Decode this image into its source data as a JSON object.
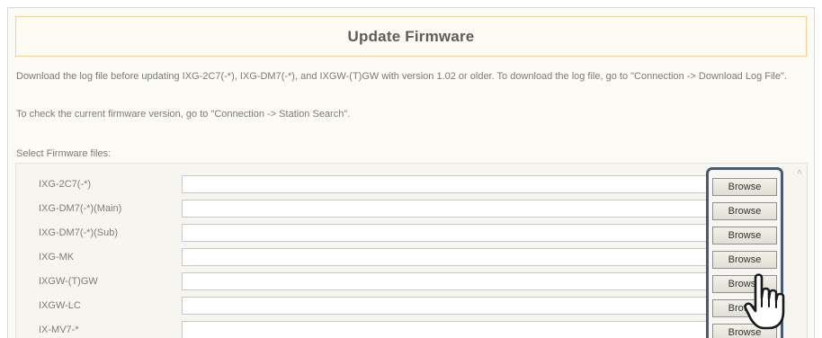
{
  "title": "Update Firmware",
  "notes": {
    "log_warning": "Download the log file before updating IXG-2C7(-*), IXG-DM7(-*), and IXGW-(T)GW with version 1.02 or older. To download the log file, go to \"Connection -> Download Log File\".",
    "version_hint": "To check the current firmware version, go to \"Connection -> Station Search\"."
  },
  "select_label": "Select Firmware files:",
  "rows": [
    {
      "label": "IXG-2C7(-*)",
      "value": "",
      "button": "Browse"
    },
    {
      "label": "IXG-DM7(-*)(Main)",
      "value": "",
      "button": "Browse"
    },
    {
      "label": "IXG-DM7(-*)(Sub)",
      "value": "",
      "button": "Browse"
    },
    {
      "label": "IXG-MK",
      "value": "",
      "button": "Browse"
    },
    {
      "label": "IXGW-(T)GW",
      "value": "",
      "button": "Browse"
    },
    {
      "label": "IXGW-LC",
      "value": "",
      "button": "Browse"
    },
    {
      "label": "IX-MV7-*",
      "value": "",
      "button": "Browse"
    }
  ],
  "colors": {
    "title_border": "#f4cf95",
    "highlight_border": "#4a5a6e",
    "panel_bg": "#f6f5ef"
  },
  "icons": {
    "cursor": "hand-pointer-icon",
    "scroll": "scroll-up-arrow-icon"
  }
}
